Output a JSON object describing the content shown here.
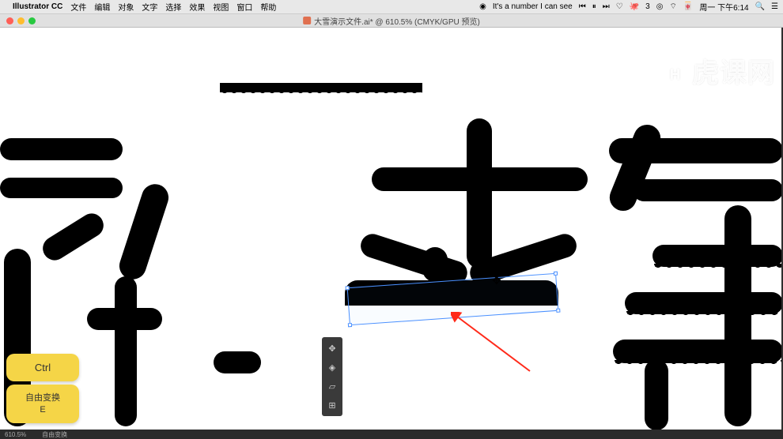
{
  "menubar": {
    "app": "Illustrator CC",
    "items": [
      "文件",
      "编辑",
      "对象",
      "文字",
      "选择",
      "效果",
      "视图",
      "窗口",
      "帮助"
    ],
    "now_playing": "It's a number I can see",
    "notif_count": "3",
    "day_time": "周一 下午6:14"
  },
  "window": {
    "doc_title": "大雪演示文件.ai* @ 610.5% (CMYK/GPU 预览)"
  },
  "tool_panel": {
    "tools": [
      "free-transform",
      "perspective",
      "distort",
      "puppet"
    ]
  },
  "key_hints": {
    "main": "Ctrl",
    "sub_label": "自由变换",
    "sub_key": "E"
  },
  "status": {
    "zoom": "610.5%",
    "tool": "自由变换"
  },
  "watermark": "虎课网",
  "media_controls": {
    "prev": "⏮",
    "pause": "⏸",
    "next": "⏭"
  }
}
